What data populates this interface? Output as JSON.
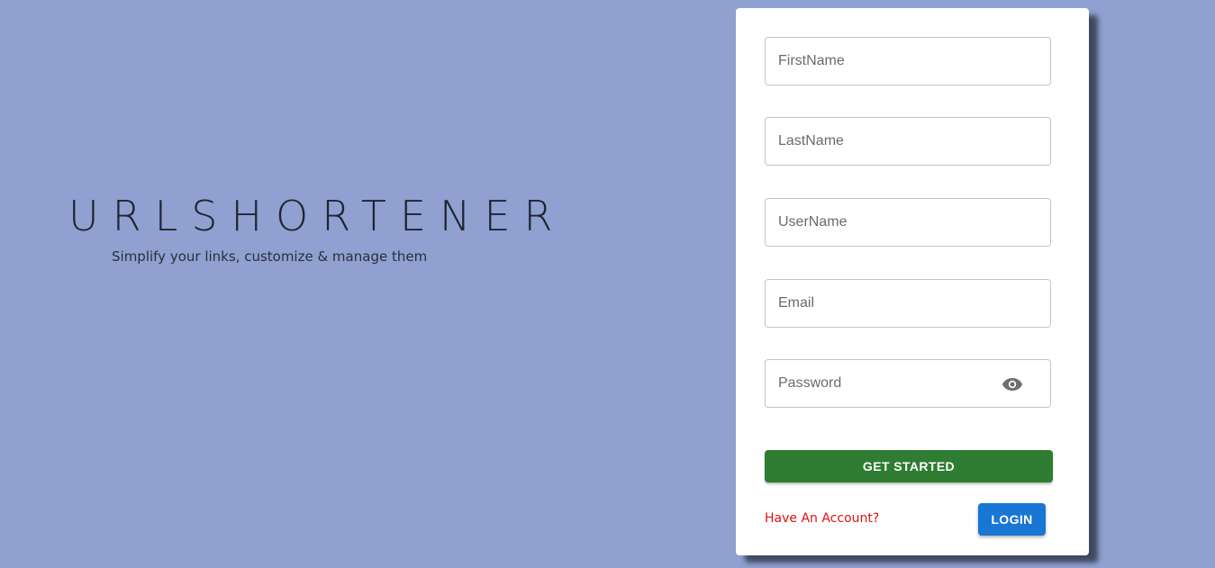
{
  "brand": {
    "title": "URLSHORTENER",
    "tagline": "Simplify your links, customize & manage them"
  },
  "form": {
    "fields": [
      {
        "placeholder": "FirstName",
        "value": ""
      },
      {
        "placeholder": "LastName",
        "value": ""
      },
      {
        "placeholder": "UserName",
        "value": ""
      },
      {
        "placeholder": "Email",
        "value": ""
      },
      {
        "placeholder": "Password",
        "value": "",
        "icon": "eye-icon"
      }
    ],
    "submit_label": "GET STARTED",
    "have_account_text": "Have An Account?",
    "login_label": "LOGIN"
  },
  "colors": {
    "background": "#8fa0d1",
    "primary_button": "#2e7d32",
    "login_button": "#1976d2",
    "have_account_text": "#e01010"
  }
}
